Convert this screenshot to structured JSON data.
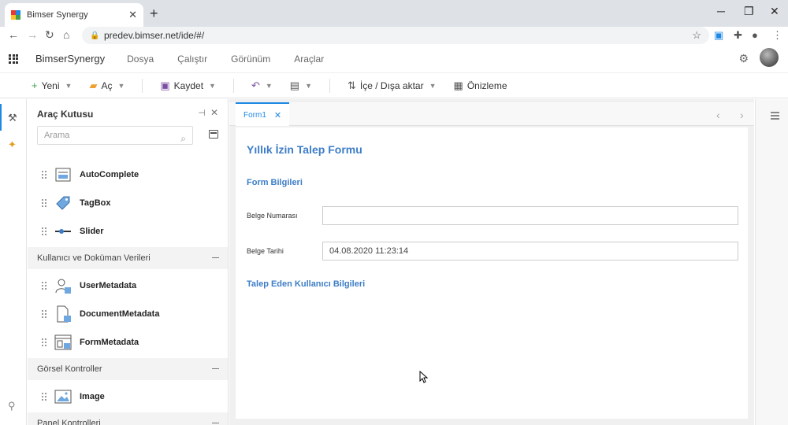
{
  "browser": {
    "tab_title": "Bimser Synergy",
    "tab_close": "✕",
    "new_tab": "+",
    "url": "predev.bimser.net/ide/#/",
    "window_minimize": "─",
    "window_restore": "❐",
    "window_close": "✕"
  },
  "app": {
    "brand": "BimserSynergy",
    "menu": [
      "Dosya",
      "Çalıştır",
      "Görünüm",
      "Araçlar"
    ]
  },
  "toolbar": {
    "new_label": "Yeni",
    "open_label": "Aç",
    "save_label": "Kaydet",
    "import_export_label": "İçe / Dışa aktar",
    "preview_label": "Önizleme"
  },
  "toolbox": {
    "title": "Araç Kutusu",
    "search_placeholder": "Arama",
    "items_top": [
      "AutoComplete",
      "TagBox",
      "Slider"
    ],
    "group_user_doc": "Kullanıcı ve Doküman Verileri",
    "items_user_doc": [
      "UserMetadata",
      "DocumentMetadata",
      "FormMetadata"
    ],
    "group_visual": "Görsel Kontroller",
    "items_visual": [
      "Image"
    ],
    "group_panel": "Panel Kontrolleri"
  },
  "designer": {
    "tab_label": "Form1",
    "form_title": "Yıllık İzin Talep Formu",
    "section_form": "Form Bilgileri",
    "label_doc_no": "Belge Numarası",
    "value_doc_no": "",
    "label_doc_date": "Belge Tarihi",
    "value_doc_date": "04.08.2020 11:23:14",
    "section_requester": "Talep Eden Kullanıcı Bilgileri"
  },
  "colors": {
    "accent": "#1e88e5",
    "form_heading": "#3d7dc7"
  }
}
